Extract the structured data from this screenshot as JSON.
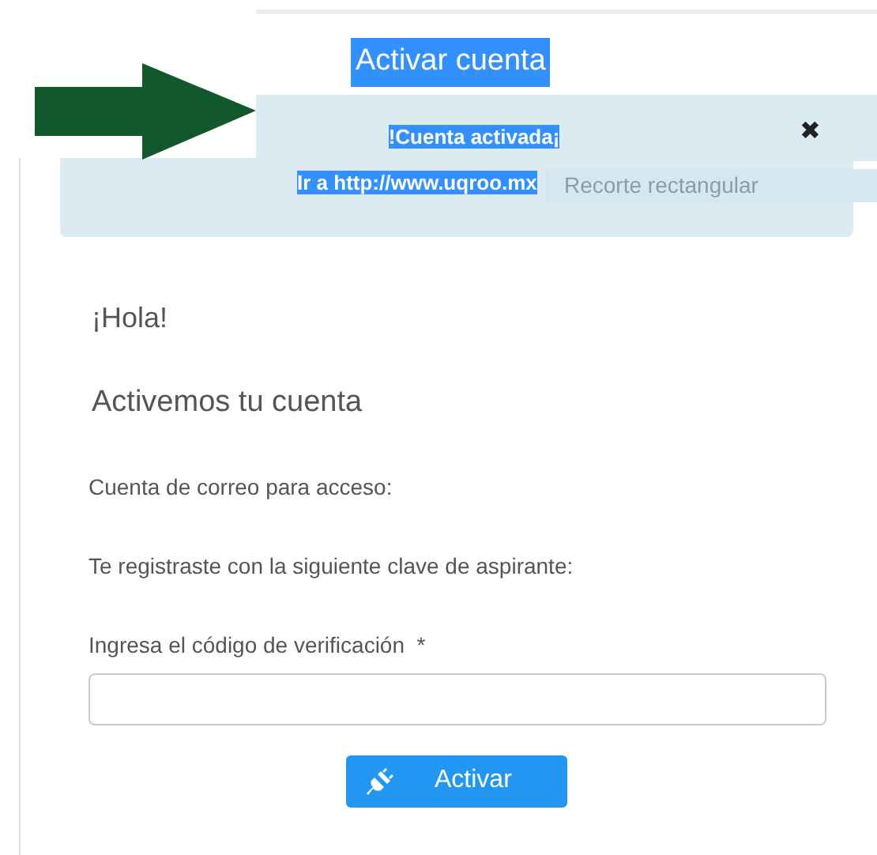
{
  "header": {
    "title": "Activar cuenta",
    "highlighted": true
  },
  "alert": {
    "lines": [
      {
        "text": "!Cuenta activada¡",
        "highlighted": true
      },
      {
        "text": "Ir a http://www.uqroo.mx",
        "highlighted": true
      }
    ],
    "close": "✖",
    "overlay_text": "Recorte rectangular"
  },
  "form": {
    "greeting": "¡Hola!",
    "subtitle": "Activemos tu cuenta",
    "fields": [
      {
        "kind": "text",
        "label": "Cuenta de correo para acceso:"
      },
      {
        "kind": "text",
        "label": "Te registraste con la siguiente clave de aspirante:"
      },
      {
        "kind": "input",
        "label": "Ingresa el código de verificación",
        "required": "*"
      }
    ],
    "button": "Activar"
  }
}
